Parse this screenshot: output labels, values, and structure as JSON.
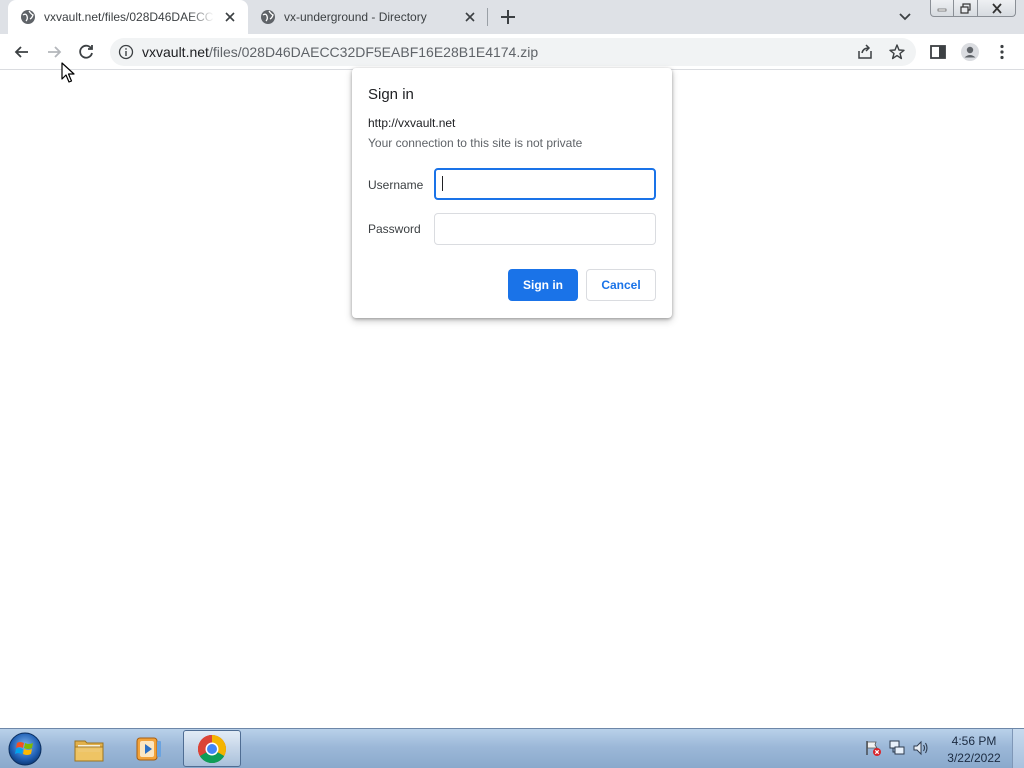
{
  "browser": {
    "tabs": [
      {
        "title": "vxvault.net/files/028D46DAECC32DF5EABF16E28B1E4174.zip",
        "active": true
      },
      {
        "title": "vx-underground - Directory",
        "active": false
      }
    ],
    "url": {
      "domain": "vxvault.net",
      "path": "/files/028D46DAECC32DF5EABF16E28B1E4174.zip"
    }
  },
  "dialog": {
    "title": "Sign in",
    "origin": "http://vxvault.net",
    "warning": "Your connection to this site is not private",
    "username_label": "Username",
    "username_value": "",
    "password_label": "Password",
    "password_value": "",
    "sign_in_label": "Sign in",
    "cancel_label": "Cancel"
  },
  "taskbar": {
    "apps": [
      {
        "name": "windows-explorer",
        "icon": "folder-icon"
      },
      {
        "name": "media-player",
        "icon": "media-player-icon"
      },
      {
        "name": "google-chrome",
        "icon": "chrome-icon",
        "active": true
      }
    ],
    "clock": {
      "time": "4:56 PM",
      "date": "3/22/2022"
    }
  },
  "colors": {
    "accent": "#1a73e8",
    "tabstrip": "#dee1e6",
    "omnibox": "#f1f3f4"
  }
}
